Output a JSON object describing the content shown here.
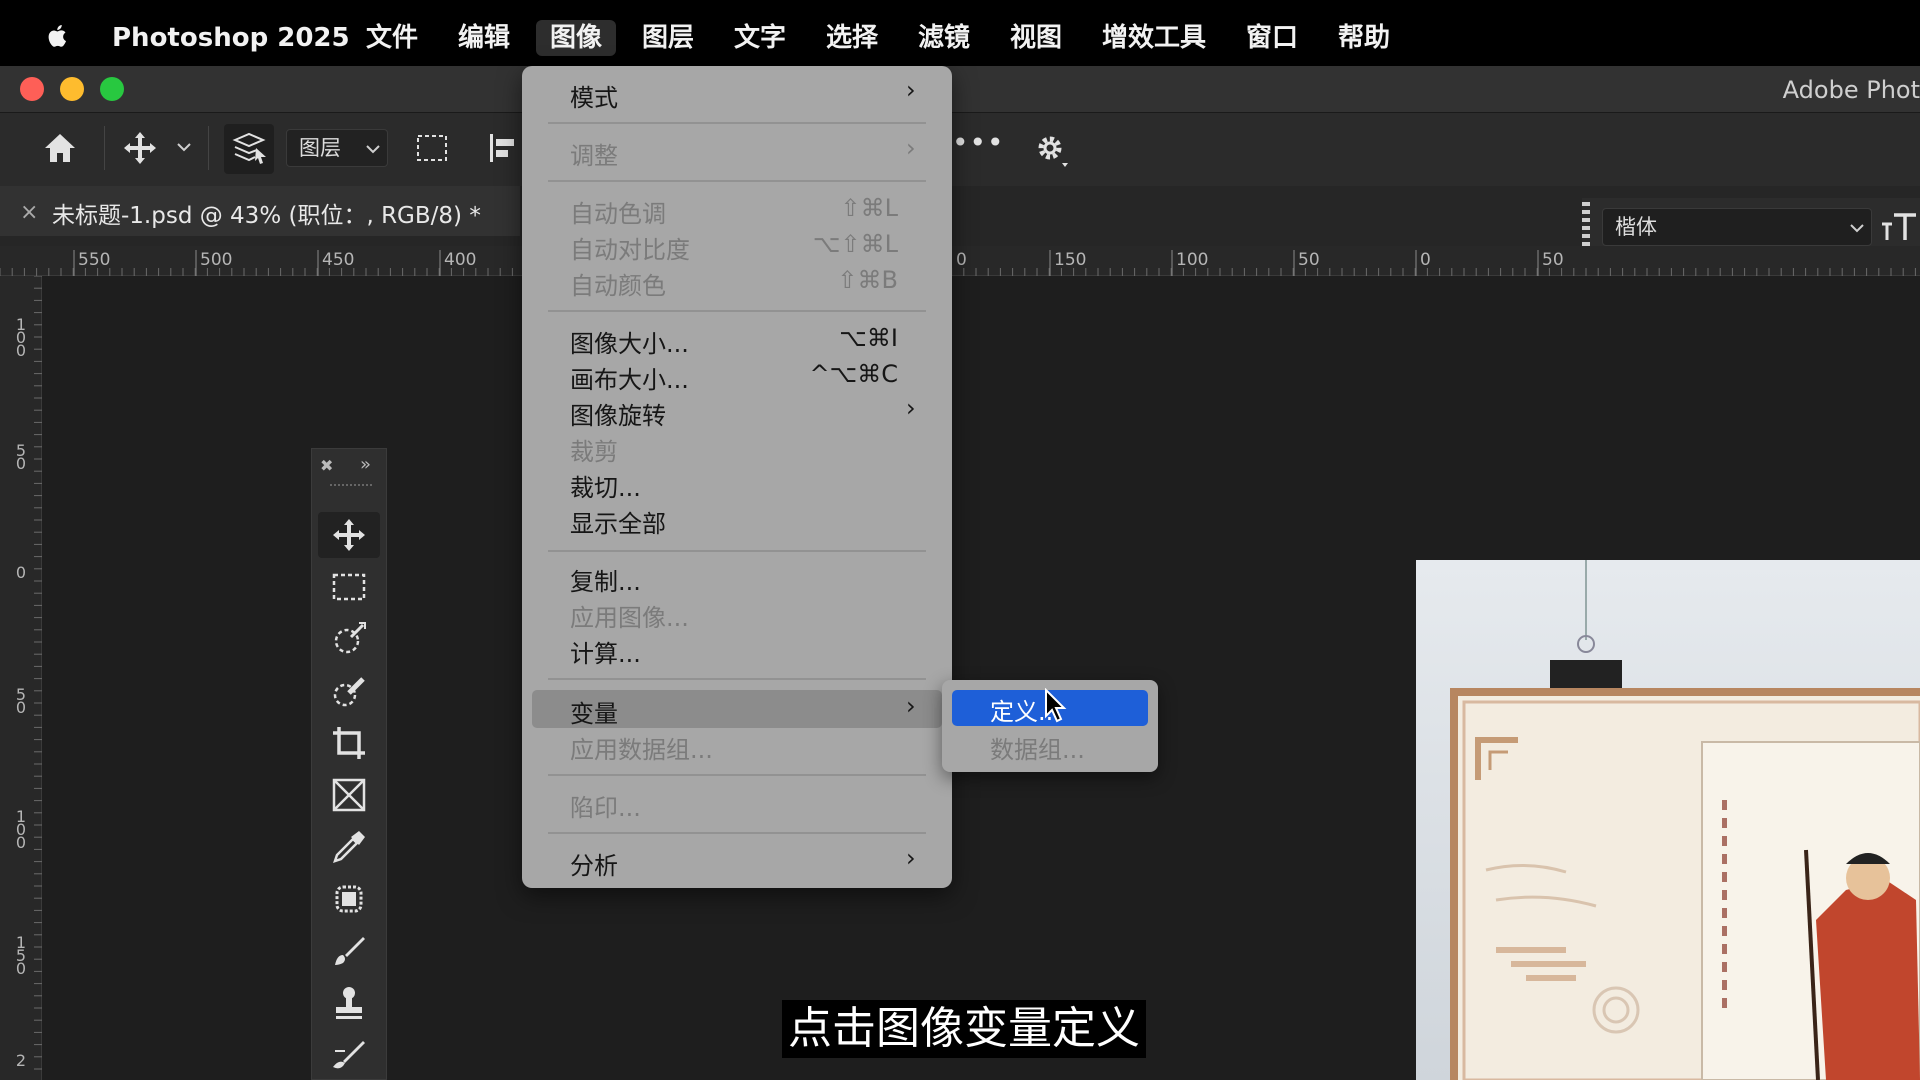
{
  "menubar": {
    "app_name": "Photoshop 2025",
    "items": [
      "文件",
      "编辑",
      "图像",
      "图层",
      "文字",
      "选择",
      "滤镜",
      "视图",
      "增效工具",
      "窗口",
      "帮助"
    ],
    "active_item": "图像"
  },
  "window": {
    "title": "Adobe Phot"
  },
  "options_bar": {
    "layer_select_label": "图层",
    "more_label": "•••"
  },
  "document": {
    "tab_close": "×",
    "tab_title": "未标题-1.psd @ 43% (职位：, RGB/8) *"
  },
  "font_panel": {
    "font_name": "楷体"
  },
  "rulers": {
    "horizontal_labels": [
      "550",
      "500",
      "450",
      "400",
      "0",
      "150",
      "100",
      "50",
      "0",
      "50"
    ],
    "vertical_labels": [
      "100",
      "50",
      "0",
      "50",
      "100",
      "150",
      "2"
    ]
  },
  "image_menu": {
    "items": [
      {
        "label": "模式",
        "submenu": true
      },
      {
        "label": "调整",
        "submenu": true,
        "disabled": true
      },
      {
        "label": "自动色调",
        "shortcut": "⇧⌘L",
        "disabled": true
      },
      {
        "label": "自动对比度",
        "shortcut": "⌥⇧⌘L",
        "disabled": true
      },
      {
        "label": "自动颜色",
        "shortcut": "⇧⌘B",
        "disabled": true
      },
      {
        "label": "图像大小...",
        "shortcut": "⌥⌘I"
      },
      {
        "label": "画布大小...",
        "shortcut": "^⌥⌘C"
      },
      {
        "label": "图像旋转",
        "submenu": true
      },
      {
        "label": "裁剪",
        "disabled": true
      },
      {
        "label": "裁切..."
      },
      {
        "label": "显示全部"
      },
      {
        "label": "复制..."
      },
      {
        "label": "应用图像...",
        "disabled": true
      },
      {
        "label": "计算..."
      },
      {
        "label": "变量",
        "submenu": true,
        "highlighted": true
      },
      {
        "label": "应用数据组...",
        "disabled": true
      },
      {
        "label": "陷印...",
        "disabled": true
      },
      {
        "label": "分析",
        "submenu": true
      }
    ]
  },
  "variables_submenu": {
    "items": [
      {
        "label": "定义...",
        "selected": true
      },
      {
        "label": "数据组...",
        "disabled": true
      }
    ]
  },
  "subtitle": "点击图像变量定义",
  "colors": {
    "menu_bg": "#a7a7a7",
    "highlight_blue": "#1e5fd8",
    "traffic_red": "#fe5f57",
    "traffic_yellow": "#febc2e",
    "traffic_green": "#28c840"
  }
}
